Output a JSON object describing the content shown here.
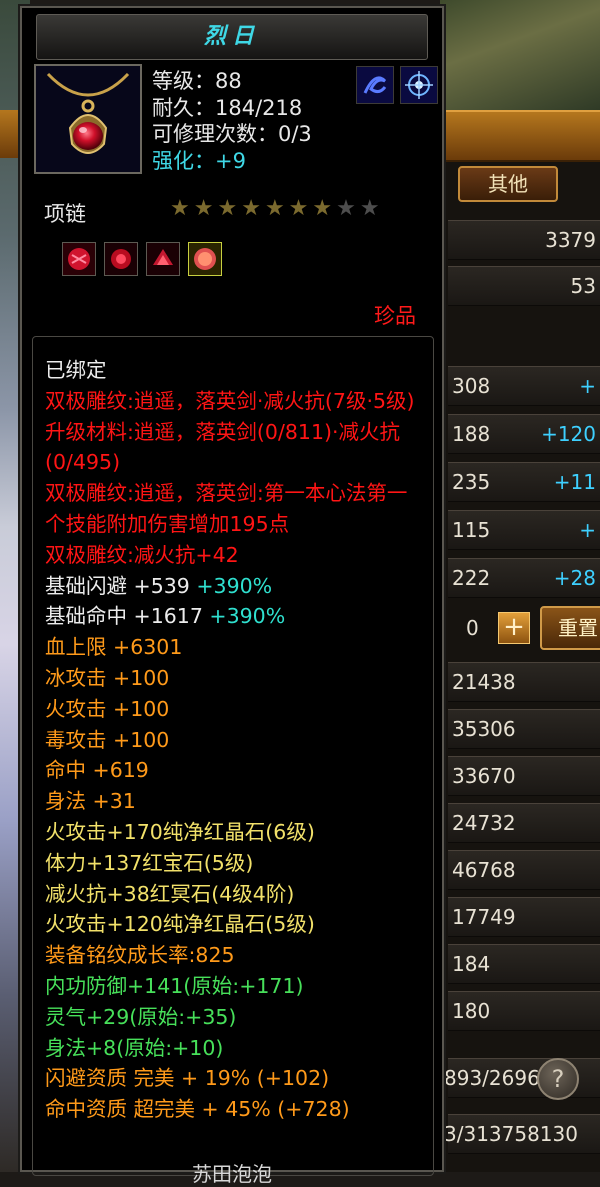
{
  "background": {
    "tab_label": "其他",
    "rows_top": [
      {
        "left": "",
        "right": "3379"
      },
      {
        "left": "",
        "right": "53"
      }
    ],
    "rows_stats": [
      {
        "left": "308",
        "right": "+"
      },
      {
        "left": "188",
        "right": "+120"
      },
      {
        "left": "235",
        "right": "+11"
      },
      {
        "left": "115",
        "right": "+"
      },
      {
        "left": "222",
        "right": "+28"
      }
    ],
    "zero": "0",
    "plus": "+",
    "reset_label": "重置",
    "values": [
      "21438",
      "35306",
      "33670",
      "24732",
      "46768",
      "17749",
      "184",
      "180"
    ],
    "progress_a": "893/2696",
    "help": "?",
    "progress_b": "3/313758130"
  },
  "tooltip": {
    "title": "烈日",
    "info": {
      "level": "等级：88",
      "durability": "耐久：184/218",
      "repair": "可修理次数：0/3",
      "enhance": "强化：+9"
    },
    "item_type": "项链",
    "stars_on": 7,
    "stars_total": 9,
    "quality": "珍品",
    "bound": "已绑定",
    "attributes": [
      {
        "text": "双极雕纹:逍遥，落英剑·减火抗(7级·5级)",
        "color": "red",
        "wrap": true
      },
      {
        "text": "升级材料:逍遥，落英剑(0/811)·减火抗(0/495)",
        "color": "red",
        "wrap": true
      },
      {
        "text": "双极雕纹:逍遥，落英剑:第一本心法第一个技能附加伤害增加195点",
        "color": "red",
        "wrap": true
      },
      {
        "text": "双极雕纹:减火抗+42",
        "color": "red"
      },
      {
        "text": "基础闪避 +539 ",
        "extra": "+390%",
        "color": "white"
      },
      {
        "text": "基础命中 +1617 ",
        "extra": "+390%",
        "color": "white"
      },
      {
        "text": "血上限 +6301",
        "color": "orange"
      },
      {
        "text": "冰攻击 +100",
        "color": "orange"
      },
      {
        "text": "火攻击 +100",
        "color": "orange"
      },
      {
        "text": "毒攻击 +100",
        "color": "orange"
      },
      {
        "text": "命中 +619",
        "color": "orange"
      },
      {
        "text": "身法 +31",
        "color": "orange"
      },
      {
        "text": "火攻击+170纯净红晶石(6级)",
        "color": "yellow"
      },
      {
        "text": "体力+137红宝石(5级)",
        "color": "yellow"
      },
      {
        "text": "减火抗+38红冥石(4级4阶)",
        "color": "yellow"
      },
      {
        "text": "火攻击+120纯净红晶石(5级)",
        "color": "yellow"
      },
      {
        "text": "装备铭纹成长率:825",
        "color": "orange"
      },
      {
        "text": "内功防御+141(原始:+171)",
        "color": "green"
      },
      {
        "text": "灵气+29(原始:+35)",
        "color": "green"
      },
      {
        "text": "身法+8(原始:+10)",
        "color": "green"
      },
      {
        "text": "闪避资质 完美 + 19% (+102)",
        "color": "orange"
      },
      {
        "text": "命中资质 超完美 + 45% (+728)",
        "color": "orange"
      }
    ],
    "bottom_cut": "苏田泡泡"
  }
}
